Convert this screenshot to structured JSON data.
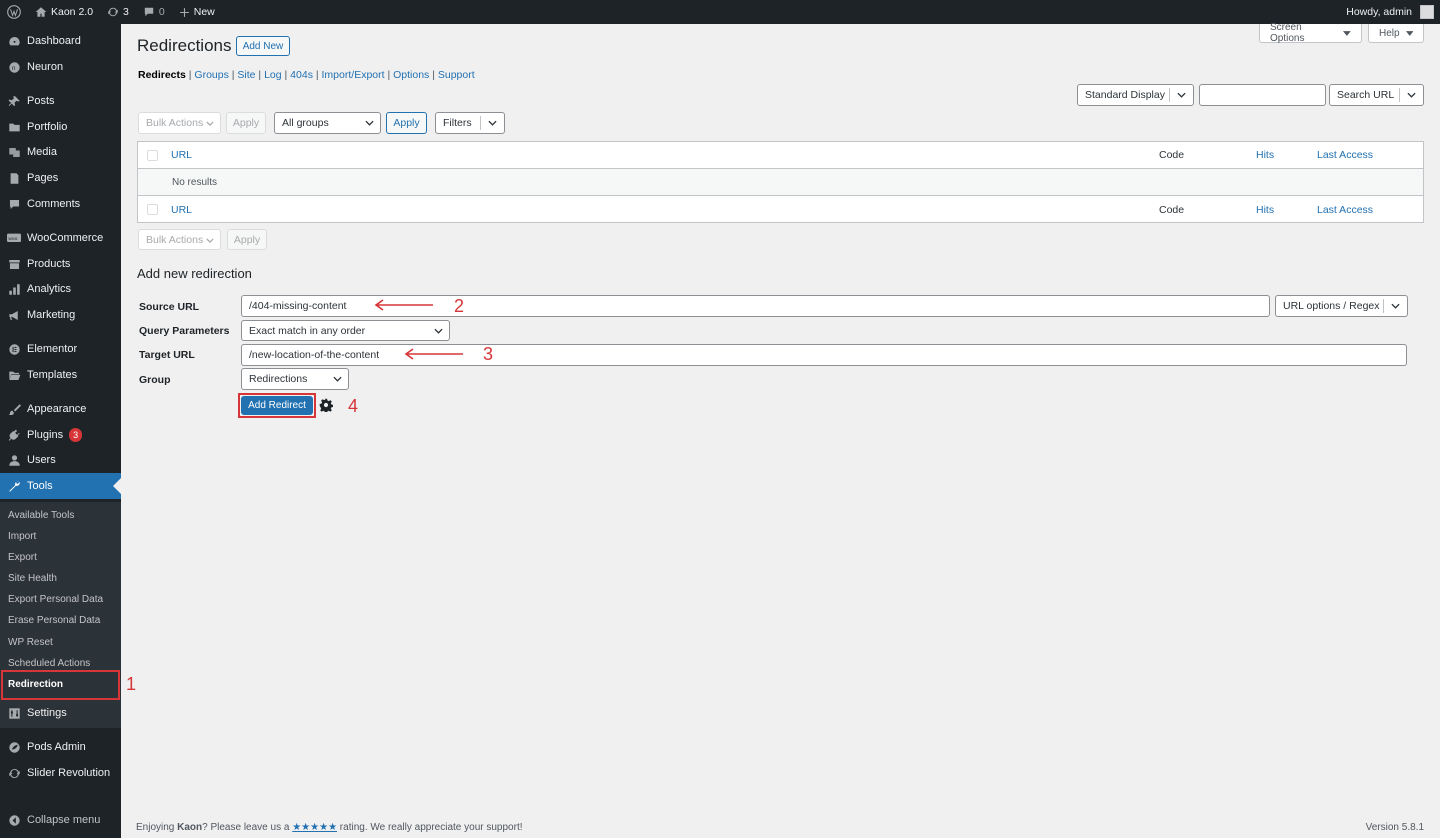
{
  "admin_bar": {
    "site_name": "Kaon 2.0",
    "updates_count": "3",
    "comments_count": "0",
    "new_label": "New",
    "greeting": "Howdy, admin"
  },
  "sidebar": {
    "items": [
      {
        "label": "Dashboard",
        "icon": "dashboard-icon"
      },
      {
        "label": "Neuron",
        "icon": "neuron-icon"
      },
      {
        "label": "Posts",
        "icon": "pin-icon"
      },
      {
        "label": "Portfolio",
        "icon": "folder-icon"
      },
      {
        "label": "Media",
        "icon": "media-icon"
      },
      {
        "label": "Pages",
        "icon": "page-icon"
      },
      {
        "label": "Comments",
        "icon": "comment-icon"
      },
      {
        "label": "WooCommerce",
        "icon": "woocommerce-icon"
      },
      {
        "label": "Products",
        "icon": "archive-icon"
      },
      {
        "label": "Analytics",
        "icon": "chart-icon"
      },
      {
        "label": "Marketing",
        "icon": "megaphone-icon"
      },
      {
        "label": "Elementor",
        "icon": "elementor-icon"
      },
      {
        "label": "Templates",
        "icon": "folder-open-icon"
      },
      {
        "label": "Appearance",
        "icon": "brush-icon"
      },
      {
        "label": "Plugins",
        "icon": "plug-icon",
        "badge": "3"
      },
      {
        "label": "Users",
        "icon": "user-icon"
      },
      {
        "label": "Tools",
        "icon": "wrench-icon"
      },
      {
        "label": "Settings",
        "icon": "settings-icon"
      },
      {
        "label": "Pods Admin",
        "icon": "pods-icon"
      },
      {
        "label": "Slider Revolution",
        "icon": "refresh-icon"
      },
      {
        "label": "Collapse menu",
        "icon": "collapse-icon"
      }
    ],
    "submenu": [
      "Available Tools",
      "Import",
      "Export",
      "Site Health",
      "Export Personal Data",
      "Erase Personal Data",
      "WP Reset",
      "Scheduled Actions",
      "Redirection"
    ]
  },
  "header": {
    "screen_options": "Screen Options",
    "help": "Help",
    "title": "Redirections",
    "add_new": "Add New"
  },
  "subnav": {
    "current": "Redirects",
    "links": [
      "Groups",
      "Site",
      "Log",
      "404s",
      "Import/Export",
      "Options",
      "Support"
    ]
  },
  "toolbar": {
    "display_select": "Standard Display",
    "search_value": "",
    "search_button": "Search URL",
    "bulk_actions": "Bulk Actions",
    "apply": "Apply",
    "group_select": "All groups",
    "filters": "Filters"
  },
  "table": {
    "columns": {
      "url": "URL",
      "code": "Code",
      "hits": "Hits",
      "last_access": "Last Access"
    },
    "empty_message": "No results"
  },
  "form": {
    "heading": "Add new redirection",
    "source_label": "Source URL",
    "source_value": "/404-missing-content",
    "url_options": "URL options / Regex",
    "query_label": "Query Parameters",
    "query_value": "Exact match in any order",
    "target_label": "Target URL",
    "target_value": "/new-location-of-the-content",
    "group_label": "Group",
    "group_value": "Redirections",
    "submit": "Add Redirect"
  },
  "annotations": [
    "1",
    "2",
    "3",
    "4"
  ],
  "footer": {
    "text_before": "Enjoying ",
    "brand": "Kaon",
    "text_middle": "? Please leave us a ",
    "stars": "★★★★★",
    "text_after": " rating. We really appreciate your support!",
    "version": "Version 5.8.1"
  },
  "colors": {
    "accent": "#2271b1",
    "annotation_red": "#d63638",
    "sidebar_bg": "#1d2327"
  }
}
